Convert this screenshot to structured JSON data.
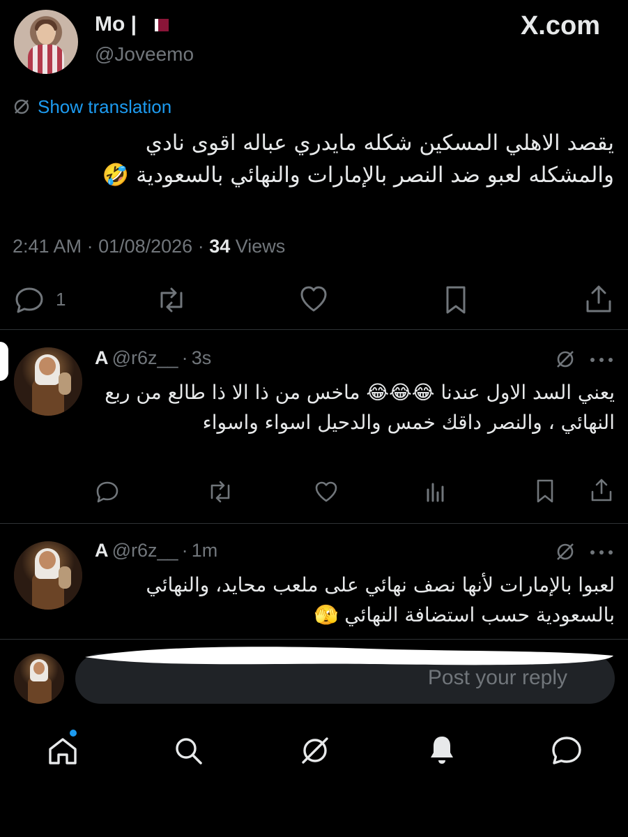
{
  "post": {
    "display_name": "Mo |",
    "handle": "@Joveemo",
    "brand": "X.com",
    "translate_label": "Show translation",
    "text_line1": "يقصد الاهلي المسكين شكله مايدري عباله اقوى نادي",
    "text_line2": "والمشكله لعبو ضد النصر بالإمارات والنهائي بالسعودية 🤣",
    "time": "2:41 AM",
    "date": "01/08/2026",
    "views_count": "34",
    "views_label": "Views",
    "reply_count": "1"
  },
  "replies": [
    {
      "name": "A",
      "handle": "@r6z__",
      "time": "3s",
      "text": "يعني السد الاول عندنا 😂😂😂 ماخس من ذا الا ذا طالع من ربع النهائي ، والنصر داقك خمس والدحيل اسواء واسواء"
    },
    {
      "name": "A",
      "handle": "@r6z__",
      "time": "1m",
      "text": "لعبوا بالإمارات لأنها نصف نهائي على ملعب محايد، والنهائي بالسعودية حسب استضافة النهائي 🫣"
    }
  ],
  "composer": {
    "placeholder": "Post your reply"
  },
  "nav": {
    "items": [
      "home-icon",
      "search-icon",
      "grok-icon",
      "bell-icon",
      "messages-icon"
    ],
    "notification_dot_color": "#1d9bf0"
  },
  "colors": {
    "background": "#000000",
    "text": "#e7e9ea",
    "secondary": "#71767b",
    "link": "#1d9bf0"
  }
}
